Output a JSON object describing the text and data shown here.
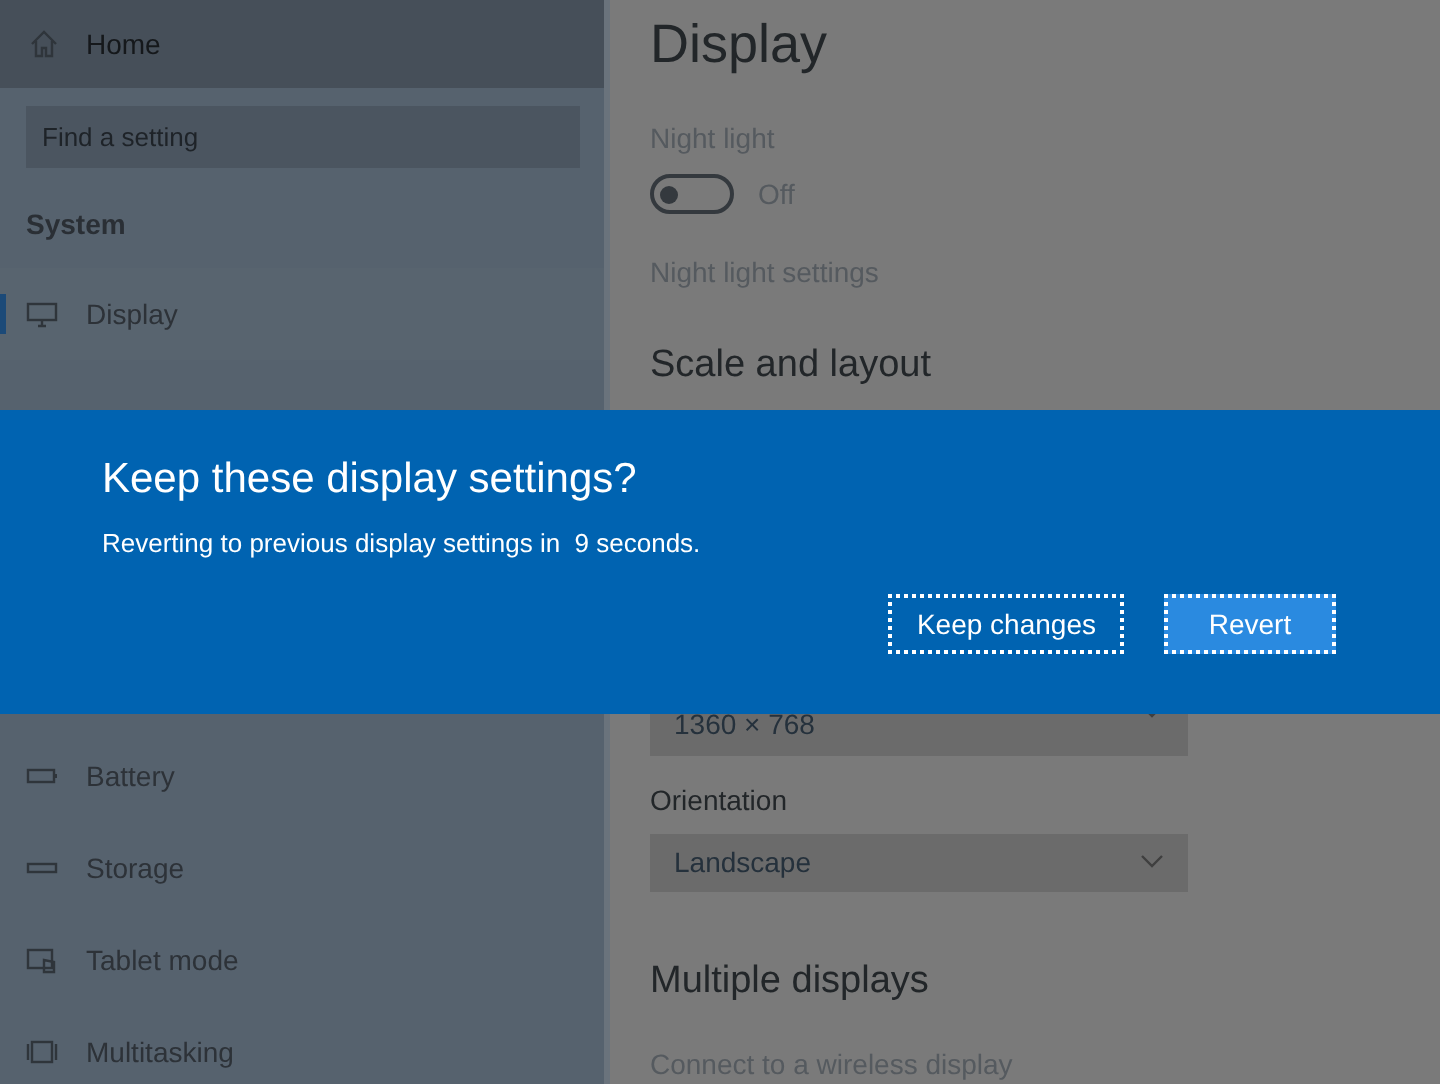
{
  "sidebar": {
    "home": "Home",
    "search": {
      "placeholder": "Find a setting"
    },
    "section": "System",
    "items": [
      {
        "label": "Display",
        "selected": true
      },
      {
        "label": "Battery",
        "selected": false
      },
      {
        "label": "Storage",
        "selected": false
      },
      {
        "label": "Tablet mode",
        "selected": false
      },
      {
        "label": "Multitasking",
        "selected": false
      }
    ]
  },
  "main": {
    "title": "Display",
    "night_light": {
      "label": "Night light",
      "on": false,
      "state": "Off"
    },
    "night_light_link": "Night light settings",
    "scale_heading": "Scale and layout",
    "resolution": {
      "value": "1360 × 768"
    },
    "orientation": {
      "label": "Orientation",
      "value": "Landscape"
    },
    "multiple_heading": "Multiple displays",
    "wireless_link": "Connect to a wireless display"
  },
  "dialog": {
    "title": "Keep these display settings?",
    "message": "Reverting to previous display settings in  9 seconds.",
    "buttons": [
      {
        "label": "Keep changes",
        "kind": "secondary"
      },
      {
        "label": "Revert",
        "kind": "primary"
      }
    ]
  }
}
